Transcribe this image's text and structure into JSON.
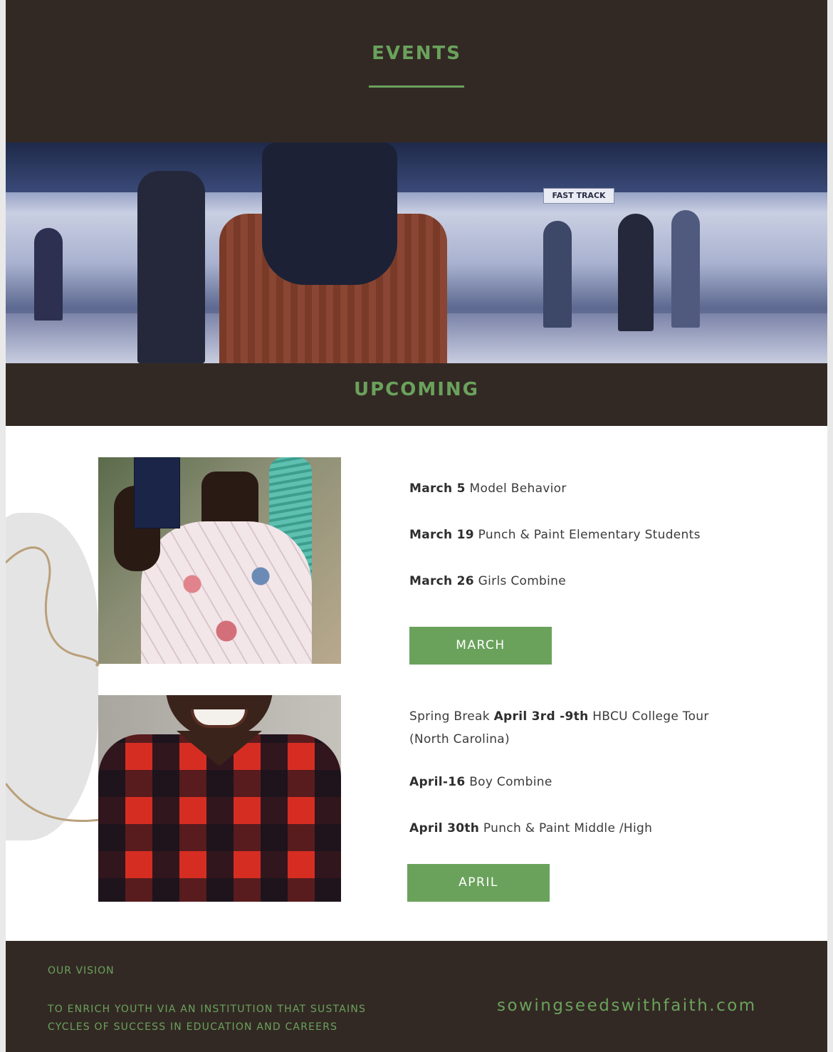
{
  "header": {
    "title": "EVENTS"
  },
  "hero": {
    "sign_text": "FAST TRACK"
  },
  "upcoming": {
    "title": "UPCOMING"
  },
  "march": {
    "events": [
      {
        "date": "March 5",
        "name": "Model Behavior"
      },
      {
        "date": "March 19",
        "name": "Punch & Paint Elementary Students"
      },
      {
        "date": "March 26",
        "name": "Girls Combine"
      }
    ],
    "button_label": "MARCH"
  },
  "april": {
    "events": [
      {
        "prefix": "Spring Break",
        "date": "April 3rd -9th",
        "name": "HBCU College Tour",
        "name_line2": "(North Carolina)"
      },
      {
        "date": "April-16",
        "name": "Boy Combine"
      },
      {
        "date": "April 30th",
        "name": "Punch & Paint Middle /High"
      }
    ],
    "button_label": "APRIL"
  },
  "footer": {
    "vision_title": "OUR VISION",
    "vision_line1": "TO ENRICH YOUTH VIA AN INSTITUTION THAT SUSTAINS",
    "vision_line2": "CYCLES OF SUCCESS IN EDUCATION AND CAREERS",
    "website": "sowingseedswithfaith.com"
  },
  "colors": {
    "accent": "#6aa25c",
    "dark": "#332924",
    "background": "#ffffff"
  }
}
